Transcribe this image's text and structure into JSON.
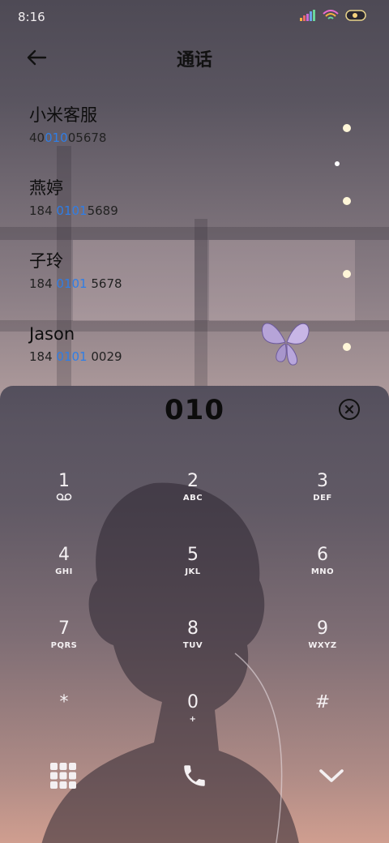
{
  "status_bar": {
    "time": "8:16"
  },
  "header": {
    "title": "通话",
    "back_icon": "arrow-left-icon"
  },
  "contacts": [
    {
      "name": "小米客服",
      "number_pre": "40",
      "number_match": "010",
      "number_post": "05678"
    },
    {
      "name": "燕婷",
      "number_pre": "184 ",
      "number_match": "0101",
      "number_post": "5689"
    },
    {
      "name": "子玲",
      "number_pre": "184 ",
      "number_match": "0101",
      "number_post": " 5678"
    },
    {
      "name": "Jason",
      "number_pre": "184 ",
      "number_match": "0101",
      "number_post": " 0029"
    }
  ],
  "dialpad": {
    "input": "010",
    "clear_icon": "clear-x-icon",
    "keys": [
      {
        "digit": "1",
        "letters": ""
      },
      {
        "digit": "2",
        "letters": "ABC"
      },
      {
        "digit": "3",
        "letters": "DEF"
      },
      {
        "digit": "4",
        "letters": "GHI"
      },
      {
        "digit": "5",
        "letters": "JKL"
      },
      {
        "digit": "6",
        "letters": "MNO"
      },
      {
        "digit": "7",
        "letters": "PQRS"
      },
      {
        "digit": "8",
        "letters": "TUV"
      },
      {
        "digit": "9",
        "letters": "WXYZ"
      },
      {
        "digit": "*",
        "letters": ""
      },
      {
        "digit": "0",
        "letters": "+"
      },
      {
        "digit": "#",
        "letters": ""
      }
    ],
    "bottom": {
      "left_icon": "grid-icon",
      "center_icon": "phone-call-icon",
      "right_icon": "chevron-down-icon"
    }
  },
  "colors": {
    "highlight": "#2f7ee6",
    "key_text": "#f4f0f2"
  }
}
